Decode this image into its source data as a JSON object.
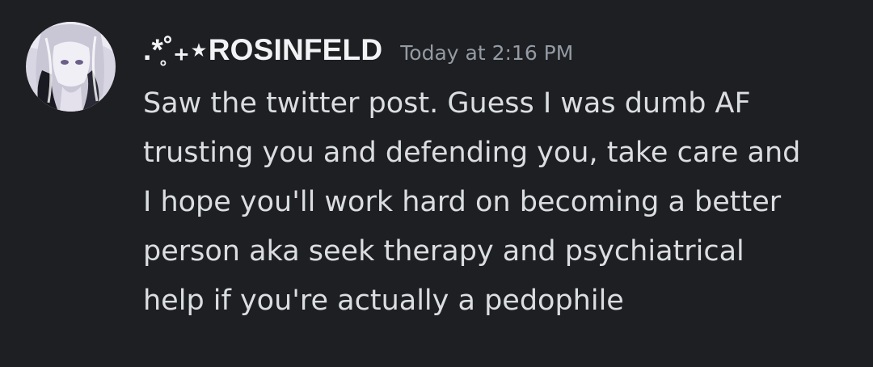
{
  "message": {
    "author": {
      "display_name": ".*̥˚₊⋆ROSINFELD",
      "avatar_icon": "anime-avatar-icon"
    },
    "timestamp": "Today at 2:16 PM",
    "lines": [
      "Saw the twitter post. Guess I was dumb AF",
      "trusting you and defending you, take care and",
      "I hope you'll work hard on becoming a better",
      "person aka seek therapy and psychiatrical",
      "help if you're actually a pedophile"
    ]
  },
  "colors": {
    "background": "#1e1f22",
    "username": "#f2f3f5",
    "timestamp": "#949ba4",
    "text": "#dbdee1"
  }
}
